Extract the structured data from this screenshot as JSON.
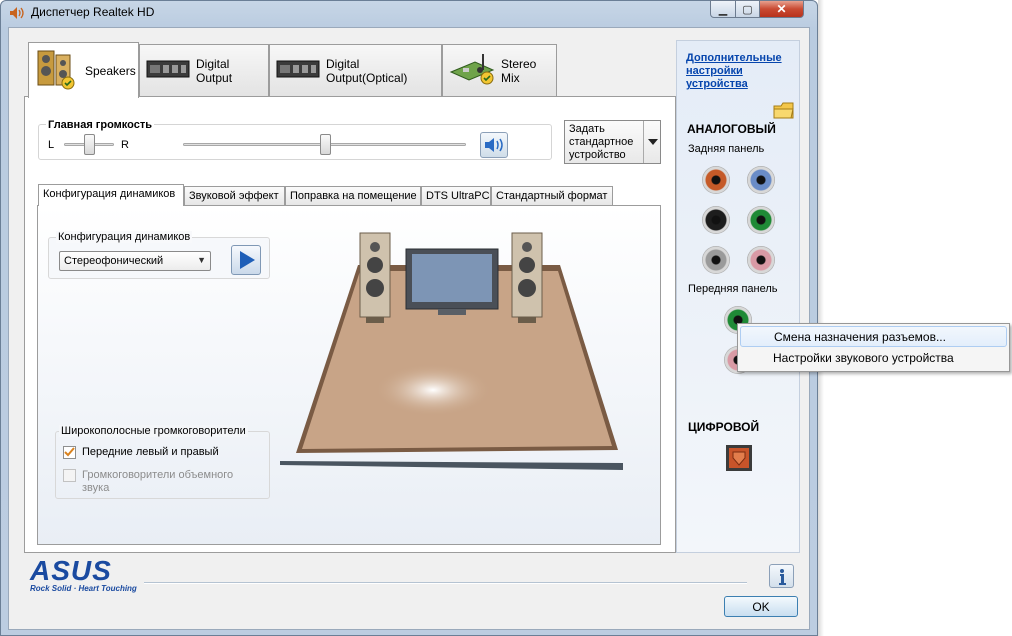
{
  "window": {
    "title": "Диспетчер Realtek HD"
  },
  "main_tabs": [
    {
      "label": "Speakers"
    },
    {
      "label": "Digital Output"
    },
    {
      "label": "Digital Output(Optical)"
    },
    {
      "label": "Stereo Mix"
    }
  ],
  "volume": {
    "title": "Главная громкость",
    "left": "L",
    "right": "R"
  },
  "default_device": {
    "label": "Задать стандартное устройство"
  },
  "sub_tabs": [
    {
      "label": "Конфигурация динамиков"
    },
    {
      "label": "Звуковой эффект"
    },
    {
      "label": "Поправка на помещение"
    },
    {
      "label": "DTS UltraPC"
    },
    {
      "label": "Стандартный формат"
    }
  ],
  "speaker_config": {
    "title": "Конфигурация динамиков",
    "selected": "Стереофонический"
  },
  "wideband": {
    "title": "Широкополосные громкоговорители",
    "front": {
      "label": "Передние левый и правый",
      "checked": true
    },
    "surround": {
      "label": "Громкоговорители объемного звука",
      "checked": false,
      "disabled": true
    }
  },
  "right_panel": {
    "advanced_link": "Дополнительные настройки устройства",
    "analog": "АНАЛОГОВЫЙ",
    "rear_panel": "Задняя панель",
    "front_panel": "Передняя панель",
    "digital": "ЦИФРОВОЙ",
    "jack_colors": {
      "orange": "#c55a28",
      "blue": "#6a8cc7",
      "black": "#1d1d1d",
      "green": "#1f8a36",
      "gray": "#9a9a9a",
      "pink": "#d99aa5"
    }
  },
  "context_menu": {
    "items": [
      {
        "label": "Смена назначения разъемов..."
      },
      {
        "label": "Настройки звукового устройства"
      }
    ]
  },
  "footer": {
    "ok": "OK",
    "brand": "ASUS",
    "tagline": "Rock Solid · Heart Touching"
  },
  "levels": {
    "balance": 0.5,
    "master_volume": 0.5
  }
}
